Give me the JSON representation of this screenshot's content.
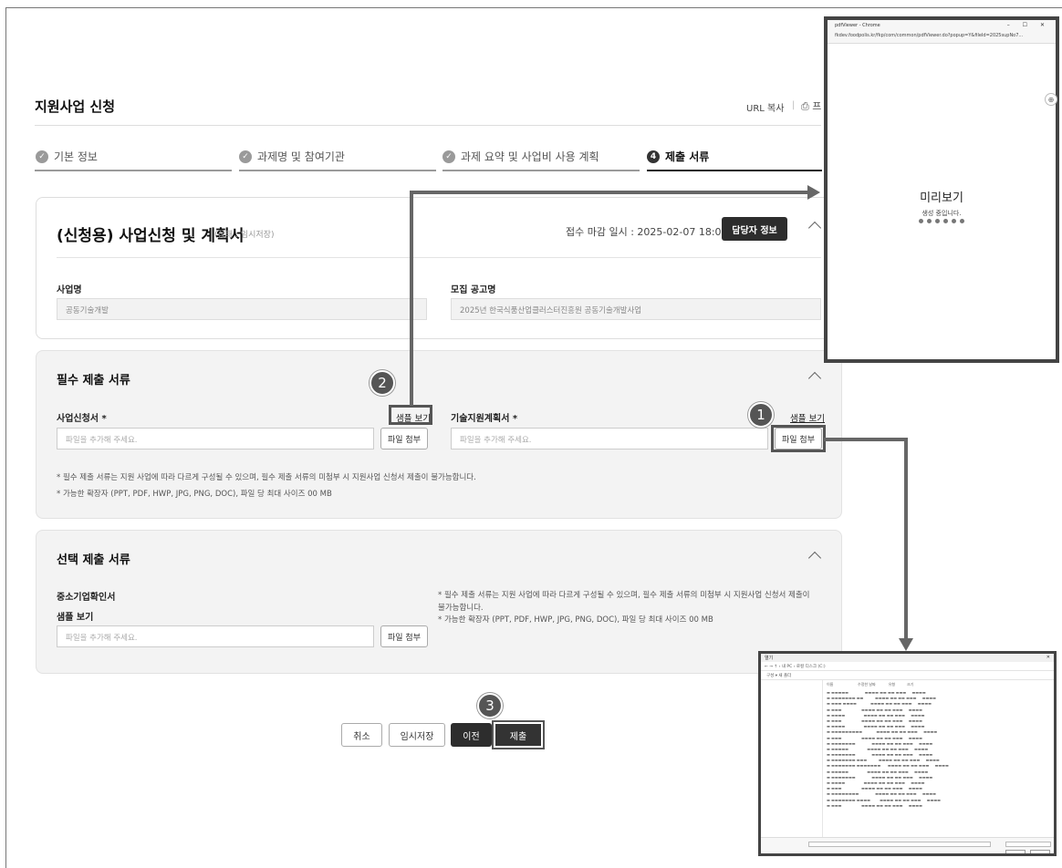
{
  "header": {
    "title": "지원사업 신청",
    "url_copy": "URL 복사",
    "separator": "|",
    "print_label": "⎙ 프"
  },
  "steps": [
    {
      "label": "기본 정보",
      "state": "done"
    },
    {
      "label": "과제명 및 참여기관",
      "state": "done"
    },
    {
      "label": "과제 요약 및 사업비 사용 계획",
      "state": "done"
    },
    {
      "label": "제출 서류",
      "state": "active",
      "number": "4"
    }
  ],
  "application": {
    "title": "(신청용) 사업신청 및 계획서",
    "status": "(상태 : 임시저장)",
    "deadline": "접수 마감 일시 : 2025-02-07 18:00:00",
    "manager_button": "담당자 정보",
    "project_name_label": "사업명",
    "project_name_value": "공동기술개발",
    "notice_label": "모집 공고명",
    "notice_value": "2025년 한국식품산업클러스터진흥원 공동기술개발사업"
  },
  "required_docs": {
    "title": "필수 제출 서류",
    "doc1_label": "사업신청서 *",
    "doc1_sample": "샘플 보기",
    "doc1_placeholder": "파일을 추가해 주세요.",
    "doc1_attach": "파일 첨부",
    "doc2_label": "기술지원계획서 *",
    "doc2_sample": "샘플 보기",
    "doc2_placeholder": "파일을 추가해 주세요.",
    "doc2_attach": "파일 첨부",
    "note1": "* 필수 제출 서류는 지원 사업에 따라 다르게 구성될 수 있으며, 필수 제출 서류의 미첨부 시 지원사업 신청서 제출이 불가능합니다.",
    "note2": "* 가능한 확장자 (PPT, PDF, HWP, JPG, PNG, DOC), 파일 당 최대 사이즈 00 MB"
  },
  "optional_docs": {
    "title": "선택 제출 서류",
    "doc_label": "중소기업확인서",
    "sample": "샘플 보기",
    "placeholder": "파일을 추가해 주세요.",
    "attach": "파일 첨부",
    "note1a": "* 필수 제출 서류는 지원 사업에 따라 다르게 구성될 수 있으며, 필수 제출 서류의 미첨부 시 지원사업 신청서 제출이",
    "note1b": "불가능합니다.",
    "note2": "* 가능한 확장자 (PPT, PDF, HWP, JPG, PNG, DOC), 파일 당 최대 사이즈 00 MB"
  },
  "footer": {
    "cancel": "취소",
    "temp_save": "임시저장",
    "prev": "이전",
    "submit": "제출"
  },
  "badges": [
    "1",
    "2",
    "3"
  ],
  "preview_popup": {
    "window_title": "pdfViewer - Chrome",
    "window_controls": "– ☐ ✕",
    "url": "fkdev.foodpolis.kr/fkp/com/common/pdfViewer.do?popup=Y&fileId=2025supNo7...",
    "title": "미리보기",
    "subtitle": "생성 중입니다."
  },
  "file_dialog": {
    "title": "열기",
    "close": "✕",
    "address": "←  →  ↑   › 내 PC › 로컬 디스크 (C:)",
    "toolbar": "구성 ▾    새 폴더",
    "header": "이름                     수정한 날짜           유형          크기"
  },
  "colors": {
    "accent_dark": "#2d2d2d",
    "callout": "#555555",
    "section_bg": "#f3f3f3"
  }
}
